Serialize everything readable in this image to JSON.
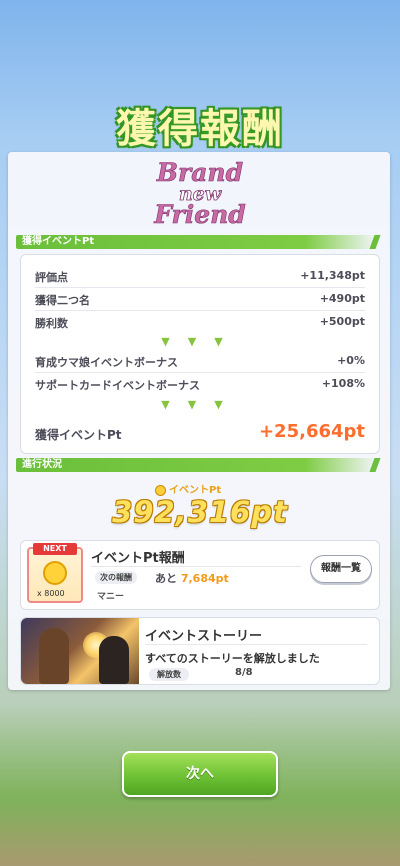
{
  "header": {
    "title": "獲得報酬"
  },
  "event_logo": {
    "line1": "Brand",
    "line2": "new",
    "line3": "Friend"
  },
  "points_section": {
    "label": "獲得イベントPt",
    "base_rows": [
      {
        "label": "評価点",
        "value": "+11,348pt"
      },
      {
        "label": "獲得二つ名",
        "value": "+490pt"
      },
      {
        "label": "勝利数",
        "value": "+500pt"
      }
    ],
    "arrows": "▼▼▼",
    "bonus_rows": [
      {
        "label": "育成ウマ娘イベントボーナス",
        "value": "+0%"
      },
      {
        "label": "サポートカードイベントボーナス",
        "value": "+108%"
      }
    ],
    "total": {
      "label": "獲得イベントPt",
      "value": "+25,664pt"
    }
  },
  "progress_section": {
    "label": "進行状況",
    "badge": "イベントPt",
    "total_points": "392,316pt",
    "reward": {
      "next_tag": "NEXT",
      "quantity": "x 8000",
      "title": "イベントPt報酬",
      "next_label": "次の報酬",
      "remaining_prefix": "あと",
      "remaining_value": "7,684pt",
      "item_name": "マニー",
      "list_button": "報酬一覧"
    },
    "story": {
      "title": "イベントストーリー",
      "description": "すべてのストーリーを解放しました",
      "unlock_label": "解放数",
      "unlock_value": "8/8"
    }
  },
  "footer": {
    "next_button": "次へ"
  },
  "colors": {
    "accent_green": "#6bbf3a",
    "highlight_orange": "#ff6d2e",
    "gold": "#ffe05c"
  }
}
